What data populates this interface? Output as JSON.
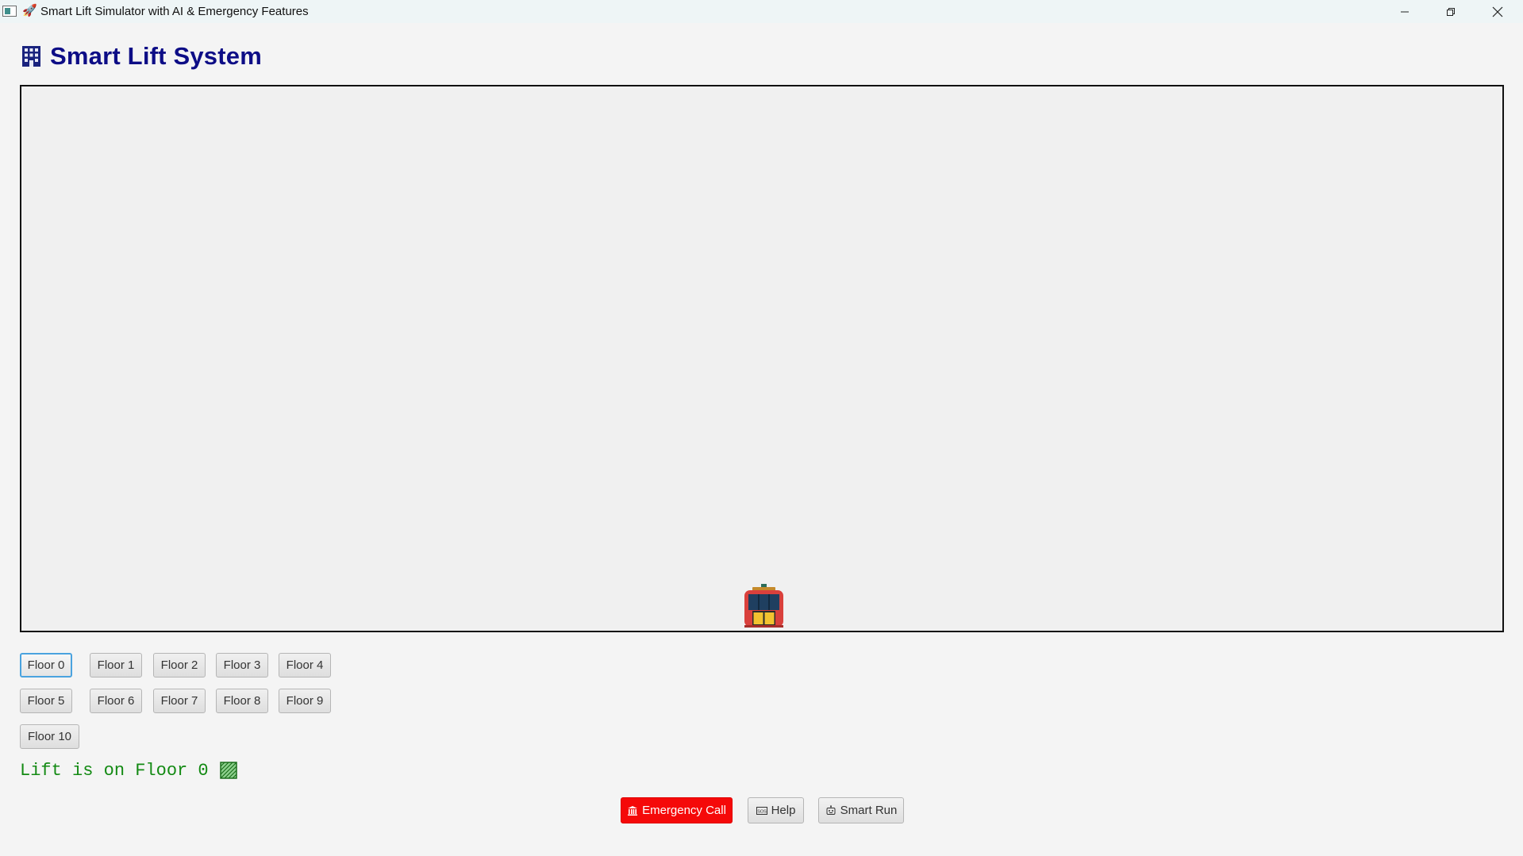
{
  "window": {
    "title": "Smart Lift Simulator with AI & Emergency Features",
    "title_icon": "rocket-icon",
    "controls": [
      "minimize-icon",
      "restore-icon",
      "close-icon"
    ]
  },
  "header": {
    "icon": "office-building-icon",
    "title": "Smart Lift System"
  },
  "shaft": {
    "current_floor": 0,
    "total_floors": 10,
    "lift_icon": "lift-car-icon"
  },
  "floor_buttons": [
    {
      "label": "Floor 0",
      "selected": true
    },
    {
      "label": "Floor 1",
      "selected": false
    },
    {
      "label": "Floor 2",
      "selected": false
    },
    {
      "label": "Floor 3",
      "selected": false
    },
    {
      "label": "Floor 4",
      "selected": false
    },
    {
      "label": "Floor 5",
      "selected": false
    },
    {
      "label": "Floor 6",
      "selected": false
    },
    {
      "label": "Floor 7",
      "selected": false
    },
    {
      "label": "Floor 8",
      "selected": false
    },
    {
      "label": "Floor 9",
      "selected": false
    },
    {
      "label": "Floor 10",
      "selected": false
    }
  ],
  "status": {
    "text": "Lift is on Floor 0",
    "icon": "green-square-icon"
  },
  "actions": {
    "emergency": {
      "label": "Emergency Call",
      "icon": "bank-icon"
    },
    "help": {
      "label": "Help",
      "icon": "sos-icon"
    },
    "smart_run": {
      "label": "Smart Run",
      "icon": "robot-icon"
    }
  },
  "colors": {
    "heading": "#0d0d86",
    "status_text": "#138a13",
    "emergency_bg": "#f50909",
    "selected_border": "#4aa3df",
    "shaft_bg": "#f0f0f0"
  }
}
